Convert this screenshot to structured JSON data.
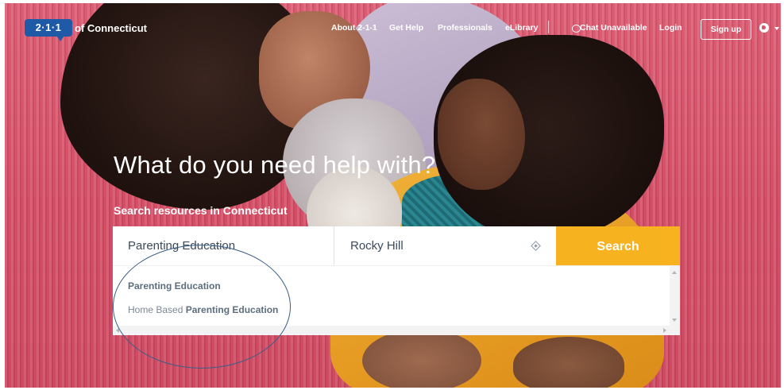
{
  "header": {
    "logo_badge": "2·1·1",
    "logo_text": "of Connecticut",
    "nav": {
      "about": "About 2-1-1",
      "get_help": "Get Help",
      "professionals": "Professionals",
      "elibrary": "eLibrary",
      "chat": "Chat Unavailable",
      "login": "Login",
      "signup": "Sign up"
    },
    "icons": {
      "chat": "chat-bubble-icon",
      "language": "globe-icon"
    }
  },
  "hero": {
    "headline": "What do you need help with?",
    "subhead": "Search resources in Connecticut"
  },
  "search": {
    "what_value": "Parenting Education",
    "where_value": "Rocky Hill",
    "button_label": "Search"
  },
  "suggestions": [
    {
      "prefix": "",
      "match": "Parenting Education"
    },
    {
      "prefix": "Home Based ",
      "match": "Parenting Education"
    }
  ],
  "colors": {
    "brand_blue": "#1f5aa6",
    "search_button": "#f6b21f",
    "hero_background": "#d9546c",
    "annotation": "#3a5f86"
  }
}
